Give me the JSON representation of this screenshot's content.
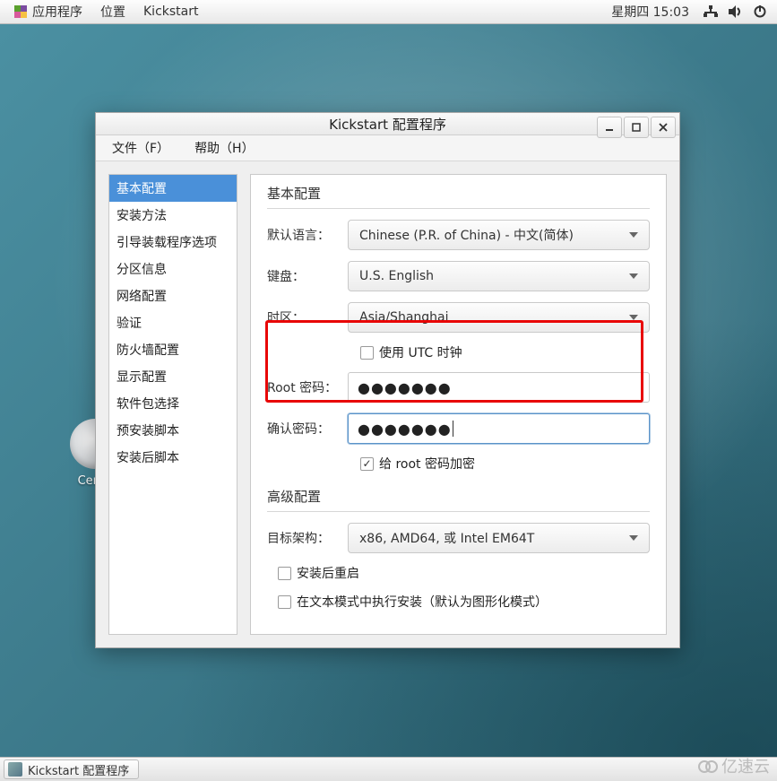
{
  "top_panel": {
    "apps_label": "应用程序",
    "places_label": "位置",
    "active_app": "Kickstart",
    "clock": "星期四 15:03"
  },
  "desktop": {
    "icon_label": "Cent..."
  },
  "window": {
    "title": "Kickstart 配置程序",
    "menu": {
      "file": "文件（F）",
      "help": "帮助（H）"
    },
    "sidebar": {
      "items": [
        "基本配置",
        "安装方法",
        "引导装载程序选项",
        "分区信息",
        "网络配置",
        "验证",
        "防火墙配置",
        "显示配置",
        "软件包选择",
        "预安装脚本",
        "安装后脚本"
      ],
      "selected_index": 0
    },
    "basic": {
      "section_title": "基本配置",
      "lang_label": "默认语言：",
      "lang_value": "Chinese (P.R. of China) - 中文(简体)",
      "kb_label": "键盘：",
      "kb_value": "U.S. English",
      "tz_label": "时区：",
      "tz_value": "Asia/Shanghai",
      "utc_label": "使用 UTC 时钟",
      "rootpw_label": "Root 密码：",
      "rootpw_value": "●●●●●●●",
      "confirm_label": "确认密码：",
      "confirm_value": "●●●●●●●",
      "encrypt_label": "给 root 密码加密"
    },
    "advanced": {
      "section_title": "高级配置",
      "arch_label": "目标架构：",
      "arch_value": "x86, AMD64, 或 Intel EM64T",
      "reboot_label": "安装后重启",
      "textmode_label": "在文本模式中执行安装（默认为图形化模式）"
    }
  },
  "taskbar": {
    "task_label": "Kickstart 配置程序"
  },
  "brand": "亿速云"
}
